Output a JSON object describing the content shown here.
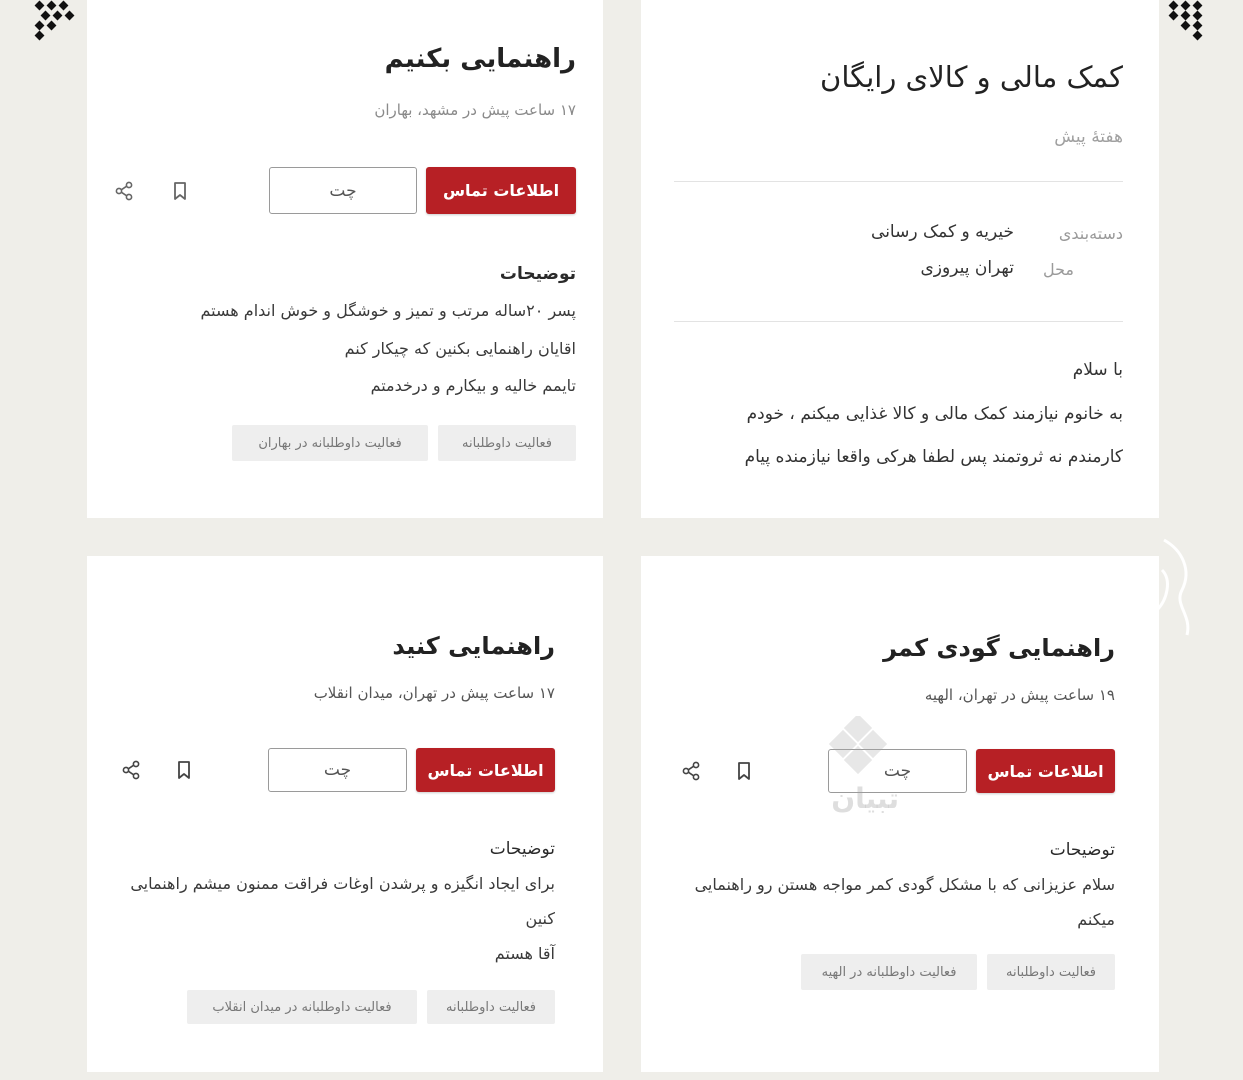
{
  "cards": [
    {
      "title": "راهنمایی بکنیم",
      "meta": "۱۷ ساعت پیش در مشهد، بهاران",
      "contact_label": "اطلاعات تماس",
      "chat_label": "چت",
      "desc_title": "توضیحات",
      "desc_lines": [
        "پسر ۲۰ساله مرتب و تمیز و خوشگل و خوش اندام هستم",
        "اقایان راهنمایی بکنین که چیکار کنم",
        "تایمم خالیه و بیکارم و درخدمتم"
      ],
      "tags": [
        "فعالیت داوطلبانه",
        "فعالیت داوطلبانه در بهاران"
      ]
    },
    {
      "title": "کمک مالی و کالای رایگان",
      "meta": "هفتهٔ پیش",
      "category_label": "دسته‌بندی",
      "category_value": "خیریه و کمک رسانی",
      "location_label": "محل",
      "location_value": "تهران پیروزی",
      "body_lines": [
        "با سلام",
        "به خانوم نیازمند کمک مالی و کالا غذایی میکنم ، خودم",
        "کارمندم نه ثروتمند پس لطفا هرکی واقعا نیازمنده پیام"
      ]
    },
    {
      "title": "راهنمایی کنید",
      "meta": "۱۷ ساعت پیش در تهران، میدان انقلاب",
      "contact_label": "اطلاعات تماس",
      "chat_label": "چت",
      "desc_title": "توضیحات",
      "desc_lines": [
        "برای ایجاد انگیزه و پرشدن اوغات فراقت ممنون میشم راهنمایی",
        "کنین",
        "آقا هستم"
      ],
      "tags": [
        "فعالیت داوطلبانه",
        "فعالیت داوطلبانه در میدان انقلاب"
      ]
    },
    {
      "title": "راهنمایی گودی کمر",
      "meta": "۱۹ ساعت پیش در تهران، الهیه",
      "contact_label": "اطلاعات تماس",
      "chat_label": "چت",
      "desc_title": "توضیحات",
      "desc_lines": [
        "سلام عزیزانی که با مشکل گودی کمر مواجه هستن رو راهنمایی",
        "میکنم"
      ],
      "tags": [
        "فعالیت داوطلبانه",
        "فعالیت داوطلبانه در الهیه"
      ]
    }
  ],
  "icons": {
    "share": "share-icon",
    "bookmark": "bookmark-icon"
  },
  "watermark": {
    "text": "تبیان"
  },
  "colors": {
    "accent": "#b72025",
    "page_bg": "#efeee9",
    "card_bg": "#ffffff"
  }
}
